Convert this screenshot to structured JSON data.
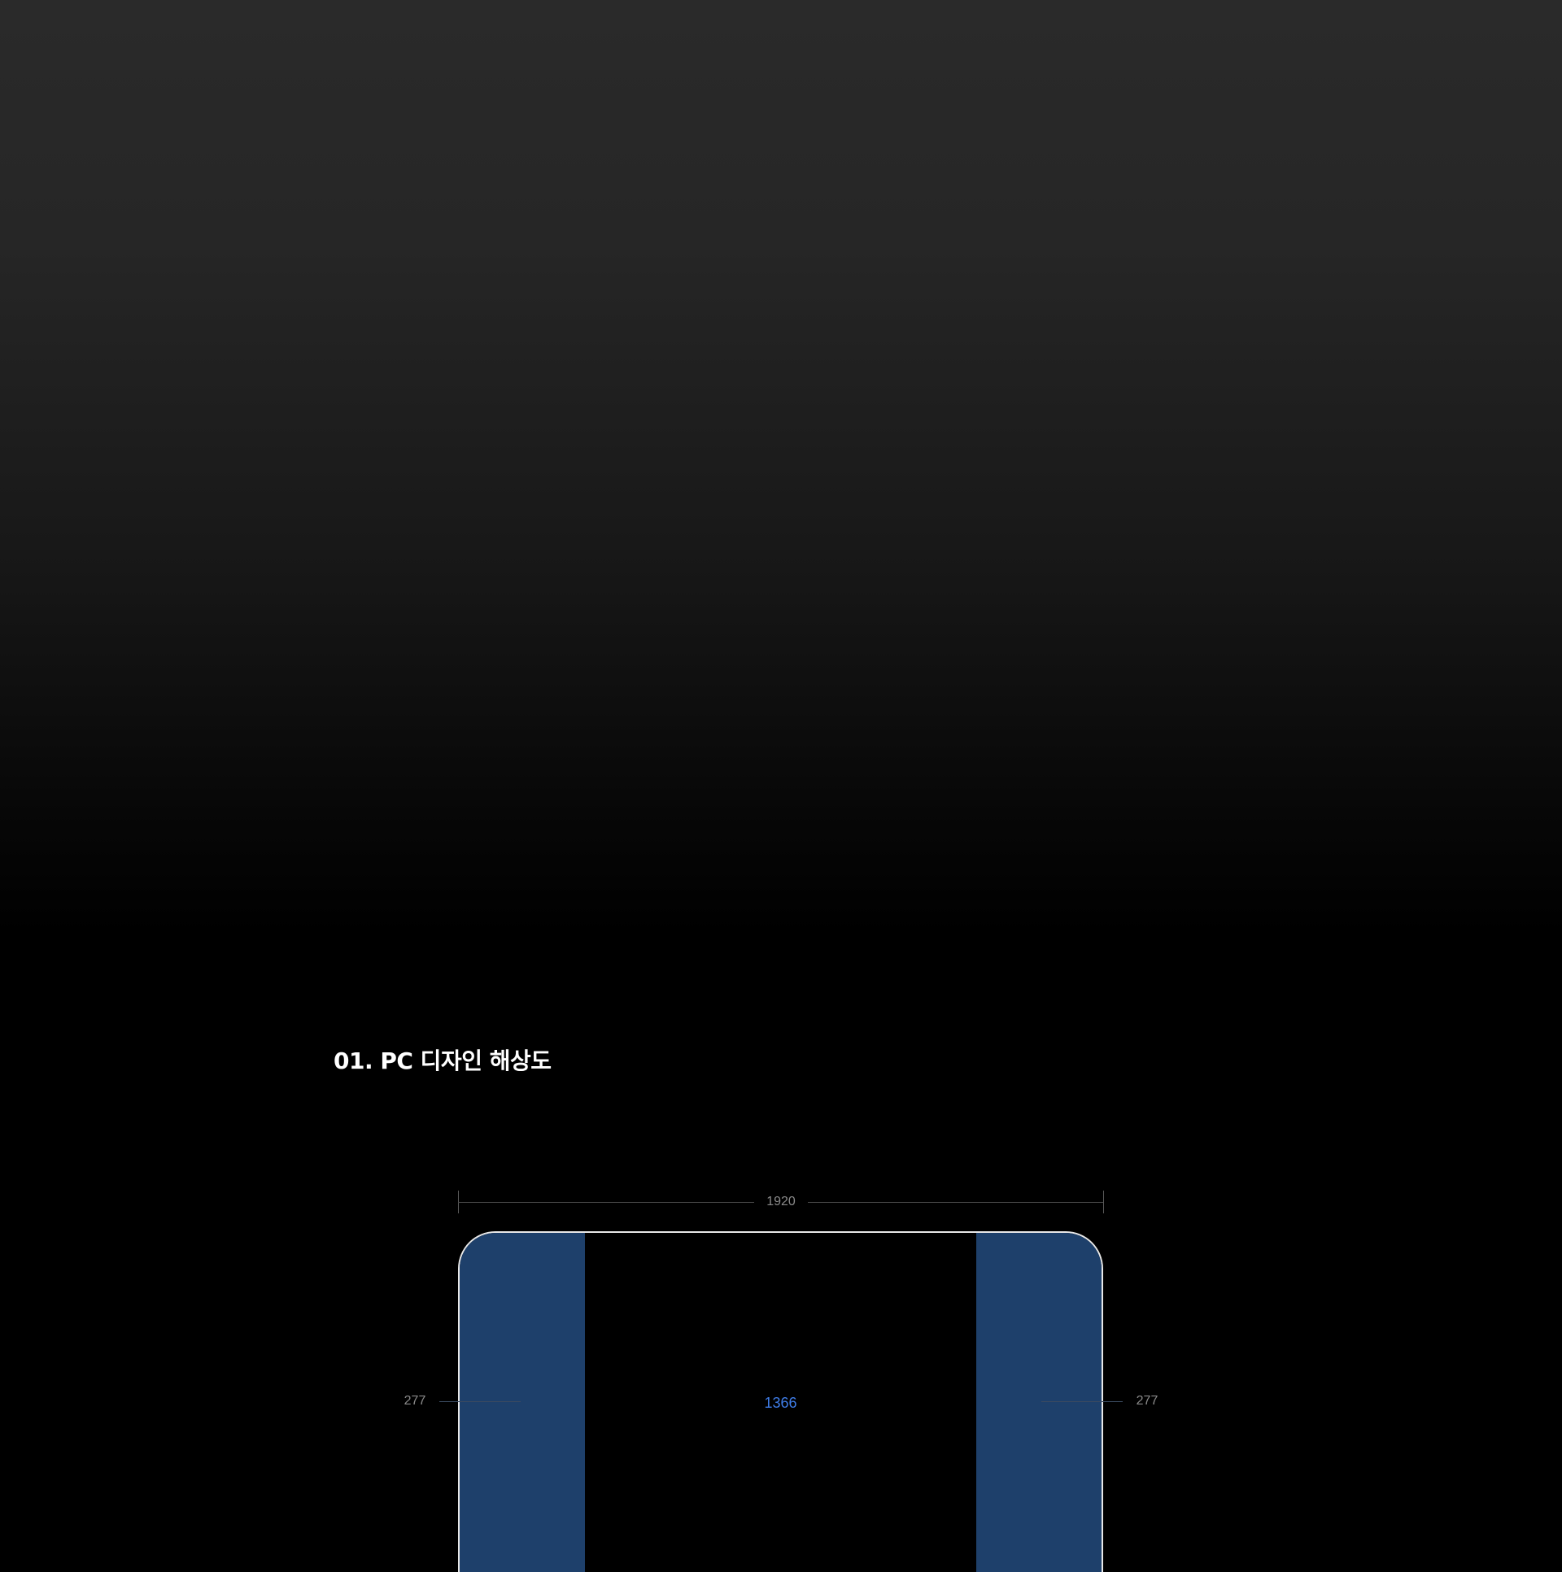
{
  "section": {
    "title": "01. PC 디자인 해상도"
  },
  "diagram": {
    "total_width_label": "1920",
    "content_width_label": "1366",
    "left_margin_label": "277",
    "right_margin_label": "277",
    "colors": {
      "margin_fill": "#1e406b",
      "content_fill": "#000000",
      "content_label": "#3f7de8",
      "frame_border": "#e8e8e8",
      "dimension_text": "#8a8a8a"
    }
  }
}
